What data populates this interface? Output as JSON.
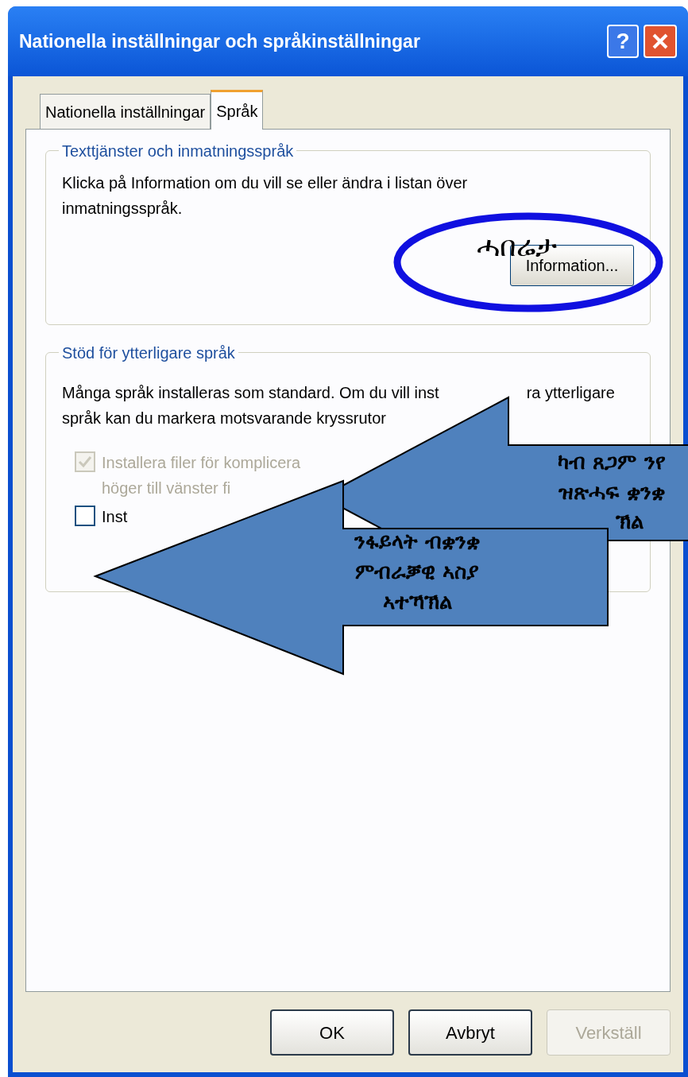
{
  "window": {
    "title": "Nationella inställningar och språkinställningar",
    "help": "?"
  },
  "tabs": [
    {
      "label": "Nationella inställningar",
      "selected": false
    },
    {
      "label": "Språk",
      "selected": true
    }
  ],
  "text_services": {
    "title": "Texttjänster och inmatningsspråk",
    "lines": [
      "Klicka på Information om du vill se eller ändra i listan över",
      "inmatningsspråk."
    ],
    "button": "Information..."
  },
  "extra_languages": {
    "title": "Stöd för ytterligare språk",
    "line_1": [
      "Många språk installeras som standard. Om du vill inst",
      "ra ytterligare"
    ],
    "line_2": "språk kan du markera motsvarande kryssrutor",
    "checkboxes": [
      {
        "lines": [
          "Installera filer för komplicera",
          "höger till vänster fi"
        ],
        "checked": true,
        "disabled": true
      },
      {
        "lines": [
          "Inst"
        ],
        "checked": false,
        "disabled": false
      }
    ]
  },
  "annotations": [
    {
      "kind": "ellipse",
      "lines": [
        "ሓበሬታ"
      ]
    },
    {
      "kind": "arrow",
      "lines": [
        "ካብ ጸጋም ንየ",
        "ዝጽሓፍ ቋንቋ",
        "ኽል"
      ]
    },
    {
      "kind": "arrow",
      "lines": [
        "ንፋይላት ብቋንቋ",
        "ምብራቓዊ ኣስያ",
        "ኣተኻኽል"
      ]
    }
  ],
  "buttons": [
    {
      "label": "OK",
      "disabled": false
    },
    {
      "label": "Avbryt",
      "disabled": false
    },
    {
      "label": "Verkställ",
      "disabled": true
    }
  ]
}
